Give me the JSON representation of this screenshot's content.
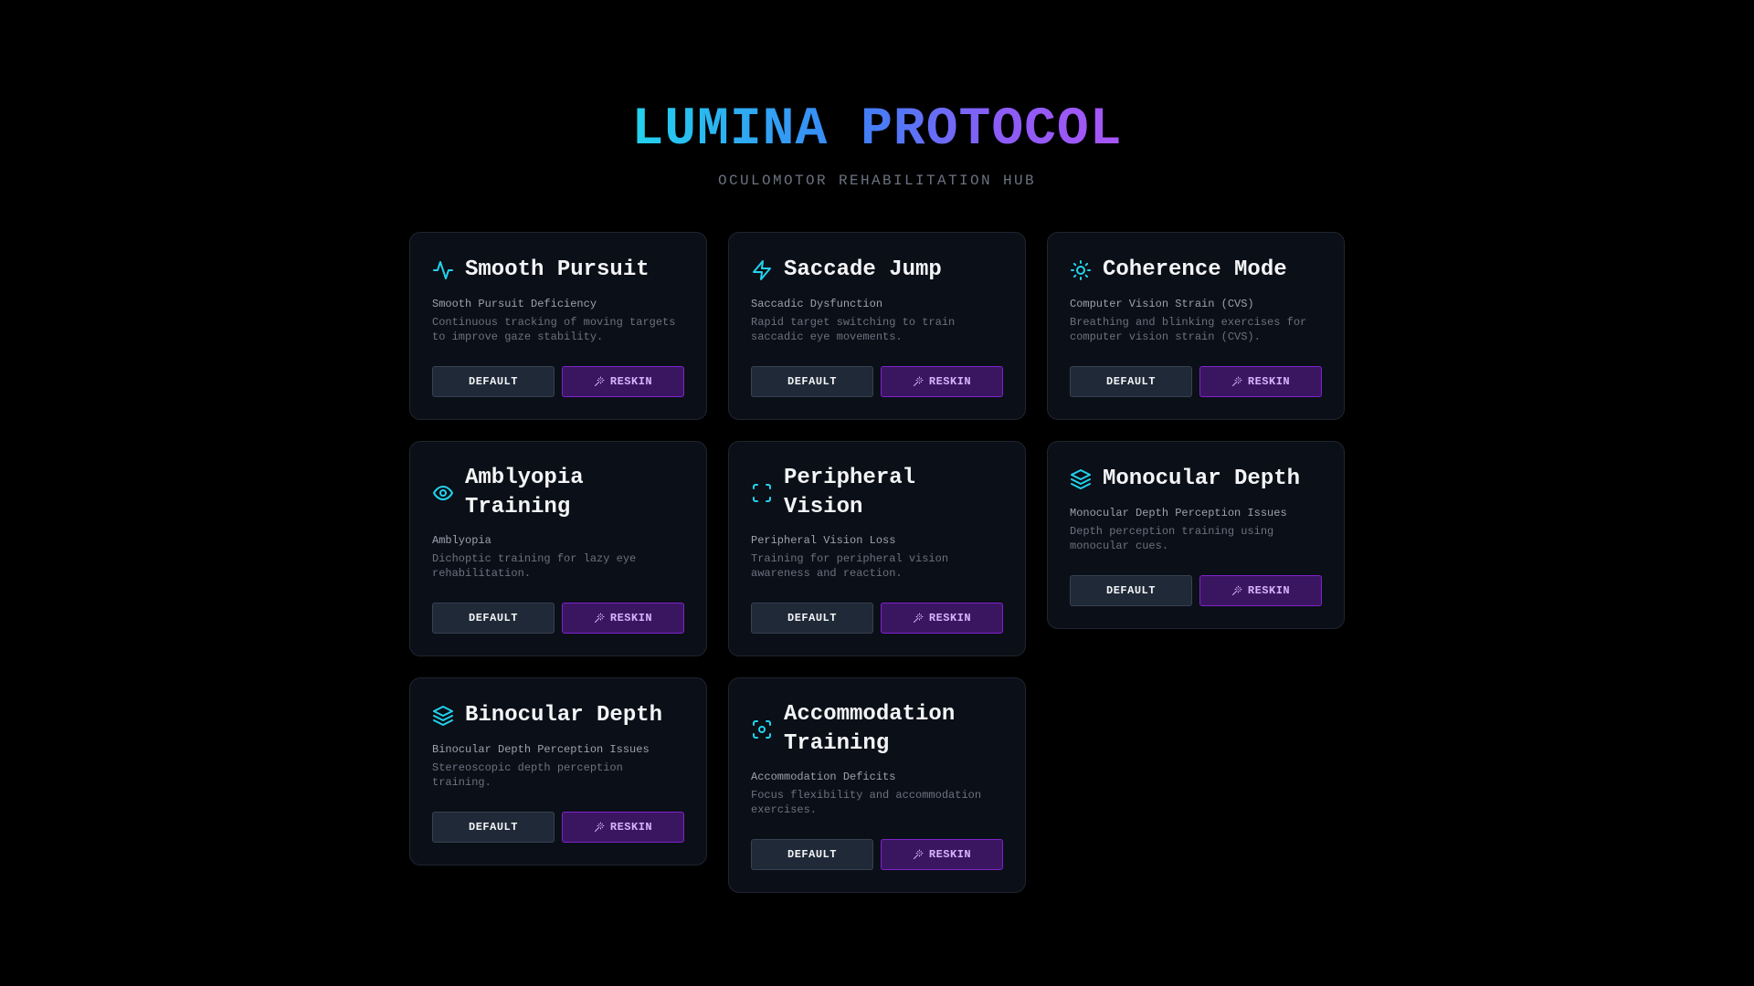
{
  "header": {
    "title": "LUMINA PROTOCOL",
    "subtitle": "OCULOMOTOR REHABILITATION HUB"
  },
  "colors": {
    "accent_cyan": "#22d3ee",
    "accent_purple": "#a855f7",
    "background": "#000000",
    "card_background": "#0b0f17"
  },
  "cards": [
    {
      "icon": "activity-icon",
      "title": "Smooth Pursuit",
      "condition": "Smooth Pursuit Deficiency",
      "description": "Continuous tracking of moving targets to improve gaze stability.",
      "default_label": "DEFAULT",
      "reskin_label": "RESKIN"
    },
    {
      "icon": "zap-icon",
      "title": "Saccade Jump",
      "condition": "Saccadic Dysfunction",
      "description": "Rapid target switching to train saccadic eye movements.",
      "default_label": "DEFAULT",
      "reskin_label": "RESKIN"
    },
    {
      "icon": "sun-icon",
      "title": "Coherence Mode",
      "condition": "Computer Vision Strain (CVS)",
      "description": "Breathing and blinking exercises for computer vision strain (CVS).",
      "default_label": "DEFAULT",
      "reskin_label": "RESKIN"
    },
    {
      "icon": "eye-icon",
      "title": "Amblyopia Training",
      "condition": "Amblyopia",
      "description": "Dichoptic training for lazy eye rehabilitation.",
      "default_label": "DEFAULT",
      "reskin_label": "RESKIN"
    },
    {
      "icon": "scan-icon",
      "title": "Peripheral Vision",
      "condition": "Peripheral Vision Loss",
      "description": "Training for peripheral vision awareness and reaction.",
      "default_label": "DEFAULT",
      "reskin_label": "RESKIN"
    },
    {
      "icon": "layers-icon",
      "title": "Monocular Depth",
      "condition": "Monocular Depth Perception Issues",
      "description": "Depth perception training using monocular cues.",
      "default_label": "DEFAULT",
      "reskin_label": "RESKIN"
    },
    {
      "icon": "layers-icon",
      "title": "Binocular Depth",
      "condition": "Binocular Depth Perception Issues",
      "description": "Stereoscopic depth perception training.",
      "default_label": "DEFAULT",
      "reskin_label": "RESKIN"
    },
    {
      "icon": "focus-icon",
      "title": "Accommodation Training",
      "condition": "Accommodation Deficits",
      "description": "Focus flexibility and accommodation exercises.",
      "default_label": "DEFAULT",
      "reskin_label": "RESKIN"
    }
  ]
}
